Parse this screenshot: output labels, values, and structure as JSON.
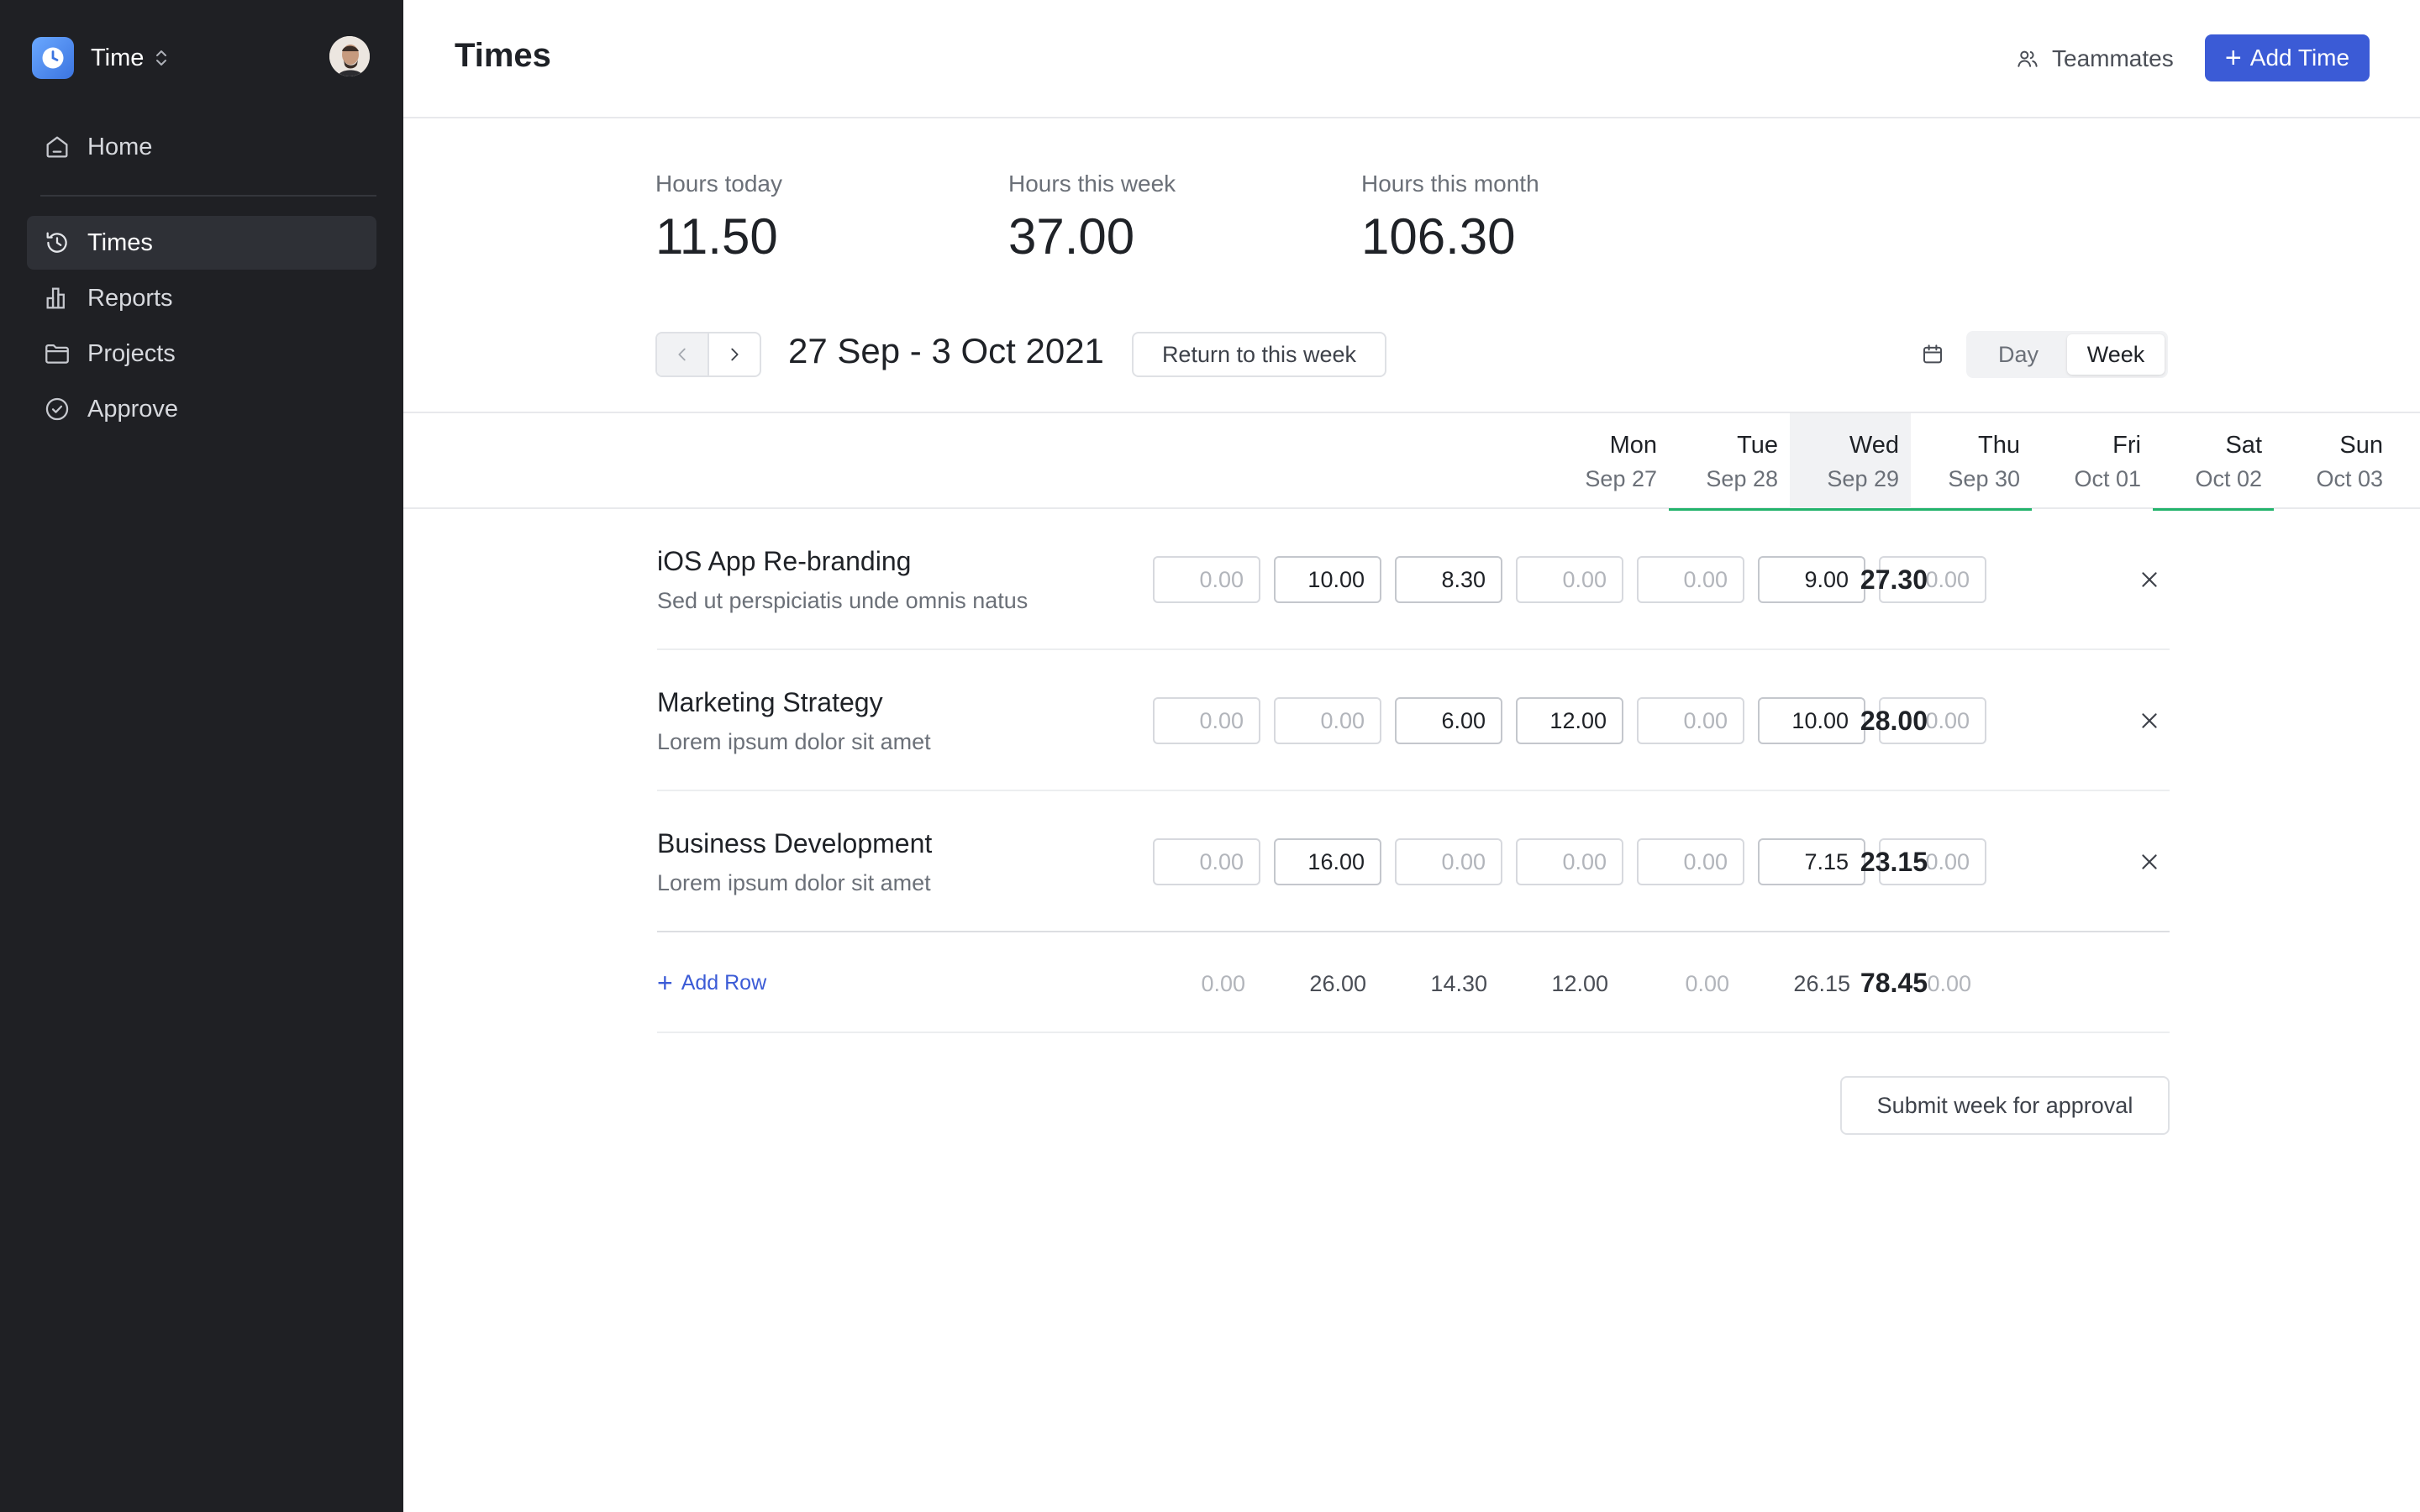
{
  "sidebar": {
    "app_name": "Time",
    "nav": [
      {
        "label": "Home",
        "icon": "home-icon"
      },
      {
        "label": "Times",
        "icon": "clock-history-icon",
        "active": true
      },
      {
        "label": "Reports",
        "icon": "bar-chart-icon"
      },
      {
        "label": "Projects",
        "icon": "folder-icon"
      },
      {
        "label": "Approve",
        "icon": "check-circle-icon"
      }
    ]
  },
  "header": {
    "title": "Times",
    "teammates_label": "Teammates",
    "add_time_label": "Add Time"
  },
  "stats": [
    {
      "label": "Hours today",
      "value": "11.50"
    },
    {
      "label": "Hours this week",
      "value": "37.00"
    },
    {
      "label": "Hours this month",
      "value": "106.30"
    }
  ],
  "week": {
    "range": "27 Sep - 3 Oct 2021",
    "return_label": "Return to this week",
    "view_options": [
      "Day",
      "Week"
    ],
    "active_view": "Week"
  },
  "days": [
    {
      "name": "Mon",
      "date": "Sep 27"
    },
    {
      "name": "Tue",
      "date": "Sep 28",
      "complete": true
    },
    {
      "name": "Wed",
      "date": "Sep 29",
      "today": true,
      "complete": true
    },
    {
      "name": "Thu",
      "date": "Sep 30",
      "complete": true
    },
    {
      "name": "Fri",
      "date": "Oct 01"
    },
    {
      "name": "Sat",
      "date": "Oct 02",
      "complete": true
    },
    {
      "name": "Sun",
      "date": "Oct 03"
    }
  ],
  "rows": [
    {
      "project": "iOS App Re-branding",
      "description": "Sed ut perspiciatis unde omnis natus",
      "hours": [
        "0.00",
        "10.00",
        "8.30",
        "0.00",
        "0.00",
        "9.00",
        "0.00"
      ],
      "total": "27.30"
    },
    {
      "project": "Marketing Strategy",
      "description": "Lorem ipsum dolor sit amet",
      "hours": [
        "0.00",
        "0.00",
        "6.00",
        "12.00",
        "0.00",
        "10.00",
        "0.00"
      ],
      "total": "28.00"
    },
    {
      "project": "Business Development",
      "description": "Lorem ipsum dolor sit amet",
      "hours": [
        "0.00",
        "16.00",
        "0.00",
        "0.00",
        "0.00",
        "7.15",
        "0.00"
      ],
      "total": "23.15"
    }
  ],
  "totals": {
    "add_row_label": "Add Row",
    "days": [
      "0.00",
      "26.00",
      "14.30",
      "12.00",
      "0.00",
      "26.15",
      "0.00"
    ],
    "grand_total": "78.45"
  },
  "submit_label": "Submit week for approval",
  "colors": {
    "sidebar_bg": "#1f2024",
    "accent": "#3b5bd6",
    "complete_bar": "#22b36b"
  }
}
